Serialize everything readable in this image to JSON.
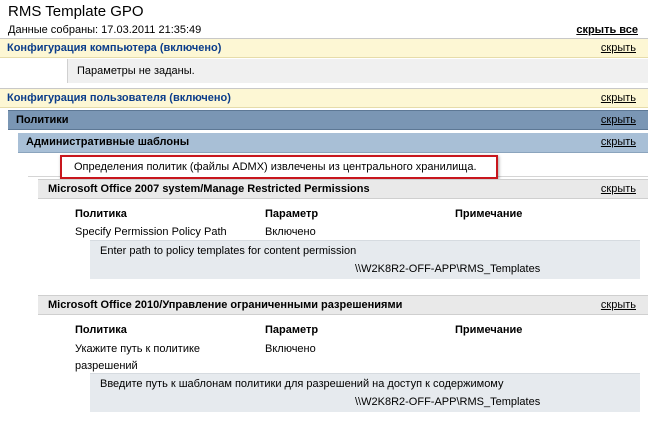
{
  "header": {
    "title": "RMS Template GPO",
    "collected": "Данные собраны: 17.03.2011 21:35:49",
    "hide_all": "скрыть все"
  },
  "computer": {
    "label": "Конфигурация компьютера (включено)",
    "hide": "скрыть",
    "no_params": "Параметры не заданы."
  },
  "user": {
    "label": "Конфигурация пользователя (включено)",
    "hide": "скрыть",
    "policies": {
      "label": "Политики",
      "hide": "скрыть",
      "admin_templates": {
        "label": "Административные шаблоны",
        "hide": "скрыть",
        "admx_note": "Определения политик (файлы ADMX) извлечены из центрального хранилища."
      }
    }
  },
  "office2007": {
    "label": "Microsoft Office 2007 system/Manage Restricted Permissions",
    "hide": "скрыть",
    "columns": [
      "Политика",
      "Параметр",
      "Примечание"
    ],
    "rows": [
      {
        "policy": "Specify Permission Policy Path",
        "setting": "Включено",
        "detail_label": "Enter path to policy templates for content permission",
        "detail_value": "\\\\W2K8R2-OFF-APP\\RMS_Templates"
      }
    ]
  },
  "office2010": {
    "label": "Microsoft Office 2010/Управление ограниченными разрешениями",
    "hide": "скрыть",
    "columns": [
      "Политика",
      "Параметр",
      "Примечание"
    ],
    "rows": [
      {
        "policy_line1": "Укажите путь к политике",
        "policy_line2": "разрешений",
        "setting": "Включено",
        "detail_label": "Введите путь к шаблонам политики для разрешений на доступ к содержимому",
        "detail_value": "\\\\W2K8R2-OFF-APP\\RMS_Templates"
      }
    ]
  },
  "colors": {
    "computer_bar": "#fdf7d4",
    "policies_bar": "#7a96b4",
    "admin_bar": "#a8bfd6",
    "office_bar": "#e9e9e9",
    "highlight_border": "#c8161d"
  }
}
